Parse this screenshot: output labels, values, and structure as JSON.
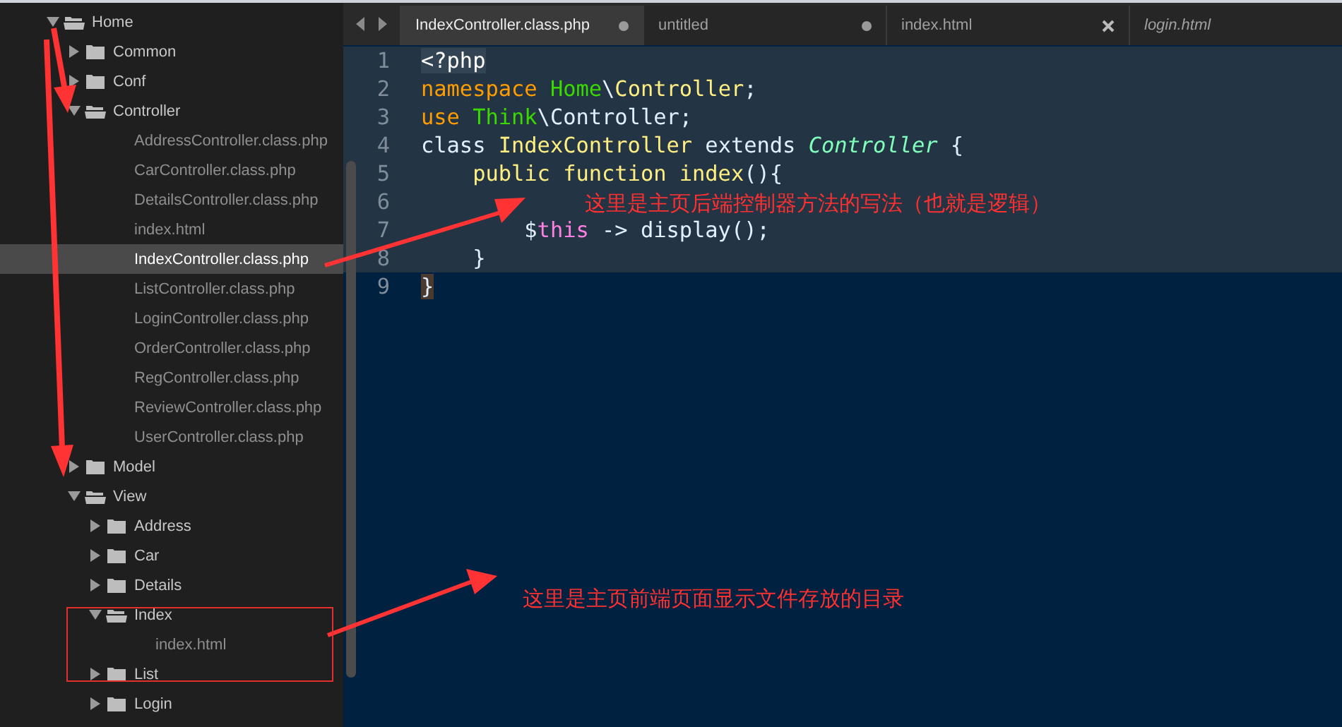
{
  "sidebar": {
    "tree": [
      {
        "label": "Home",
        "kind": "folder",
        "expanded": true,
        "selected": false,
        "children": [
          {
            "label": "Common",
            "kind": "folder",
            "expanded": false,
            "selected": false
          },
          {
            "label": "Conf",
            "kind": "folder",
            "expanded": false,
            "selected": false
          },
          {
            "label": "Controller",
            "kind": "folder",
            "expanded": true,
            "selected": false,
            "children": [
              {
                "label": "AddressController.class.php",
                "kind": "file",
                "selected": false
              },
              {
                "label": "CarController.class.php",
                "kind": "file",
                "selected": false
              },
              {
                "label": "DetailsController.class.php",
                "kind": "file",
                "selected": false
              },
              {
                "label": "index.html",
                "kind": "file",
                "selected": false
              },
              {
                "label": "IndexController.class.php",
                "kind": "file",
                "selected": true
              },
              {
                "label": "ListController.class.php",
                "kind": "file",
                "selected": false
              },
              {
                "label": "LoginController.class.php",
                "kind": "file",
                "selected": false
              },
              {
                "label": "OrderController.class.php",
                "kind": "file",
                "selected": false
              },
              {
                "label": "RegController.class.php",
                "kind": "file",
                "selected": false
              },
              {
                "label": "ReviewController.class.php",
                "kind": "file",
                "selected": false
              },
              {
                "label": "UserController.class.php",
                "kind": "file",
                "selected": false
              }
            ]
          },
          {
            "label": "Model",
            "kind": "folder",
            "expanded": false,
            "selected": false
          },
          {
            "label": "View",
            "kind": "folder",
            "expanded": true,
            "selected": false,
            "children": [
              {
                "label": "Address",
                "kind": "folder",
                "expanded": false,
                "selected": false
              },
              {
                "label": "Car",
                "kind": "folder",
                "expanded": false,
                "selected": false
              },
              {
                "label": "Details",
                "kind": "folder",
                "expanded": false,
                "selected": false
              },
              {
                "label": "Index",
                "kind": "folder",
                "expanded": true,
                "selected": false,
                "children": [
                  {
                    "label": "index.html",
                    "kind": "file",
                    "selected": false
                  }
                ]
              },
              {
                "label": "List",
                "kind": "folder",
                "expanded": false,
                "selected": false
              },
              {
                "label": "Login",
                "kind": "folder",
                "expanded": false,
                "selected": false
              }
            ]
          }
        ]
      }
    ]
  },
  "tabs": [
    {
      "label": "IndexController.class.php",
      "selected": true,
      "modified": true,
      "close_button": false,
      "preview": false
    },
    {
      "label": "untitled",
      "selected": false,
      "modified": true,
      "close_button": false,
      "preview": false
    },
    {
      "label": "index.html",
      "selected": false,
      "modified": false,
      "close_button": true,
      "preview": false
    },
    {
      "label": "login.html",
      "selected": false,
      "modified": false,
      "close_button": false,
      "preview": true
    }
  ],
  "editor": {
    "lines": [
      {
        "number": "1",
        "selected": true,
        "tokens": [
          {
            "kind": "tag",
            "text": "<?php"
          }
        ]
      },
      {
        "number": "2",
        "selected": true,
        "tokens": [
          {
            "kind": "keyword",
            "text": "namespace "
          },
          {
            "kind": "name",
            "text": "Home"
          },
          {
            "kind": "plain",
            "text": "\\"
          },
          {
            "kind": "type",
            "text": "Controller"
          },
          {
            "kind": "plain",
            "text": ";"
          }
        ]
      },
      {
        "number": "3",
        "selected": true,
        "tokens": [
          {
            "kind": "keyword",
            "text": "use "
          },
          {
            "kind": "name",
            "text": "Think"
          },
          {
            "kind": "plain",
            "text": "\\Controller;"
          }
        ]
      },
      {
        "number": "4",
        "selected": true,
        "tokens": [
          {
            "kind": "plain",
            "text": "class "
          },
          {
            "kind": "type",
            "text": "IndexController"
          },
          {
            "kind": "plain",
            "text": " extends "
          },
          {
            "kind": "inherit",
            "text": "Controller"
          },
          {
            "kind": "plain",
            "text": " {"
          }
        ]
      },
      {
        "number": "5",
        "selected": true,
        "tokens": [
          {
            "kind": "storage",
            "text": "    public function "
          },
          {
            "kind": "type",
            "text": "index"
          },
          {
            "kind": "plain",
            "text": "(){"
          }
        ]
      },
      {
        "number": "6",
        "selected": true
      },
      {
        "number": "7",
        "selected": true,
        "tokens": [
          {
            "kind": "plain",
            "text": "        $"
          },
          {
            "kind": "variable",
            "text": "this"
          },
          {
            "kind": "plain",
            "text": " -> display();"
          }
        ]
      },
      {
        "number": "8",
        "selected": true,
        "tokens": [
          {
            "kind": "plain",
            "text": "    }"
          }
        ]
      },
      {
        "number": "9",
        "selected": false,
        "tokens": [
          {
            "kind": "brace",
            "text": "}"
          }
        ]
      }
    ]
  },
  "annotations": [
    {
      "text": "这里是主页后端控制器方法的写法（也就是逻辑）"
    },
    {
      "text": "这里是主页前端页面显示文件存放的目录"
    }
  ]
}
